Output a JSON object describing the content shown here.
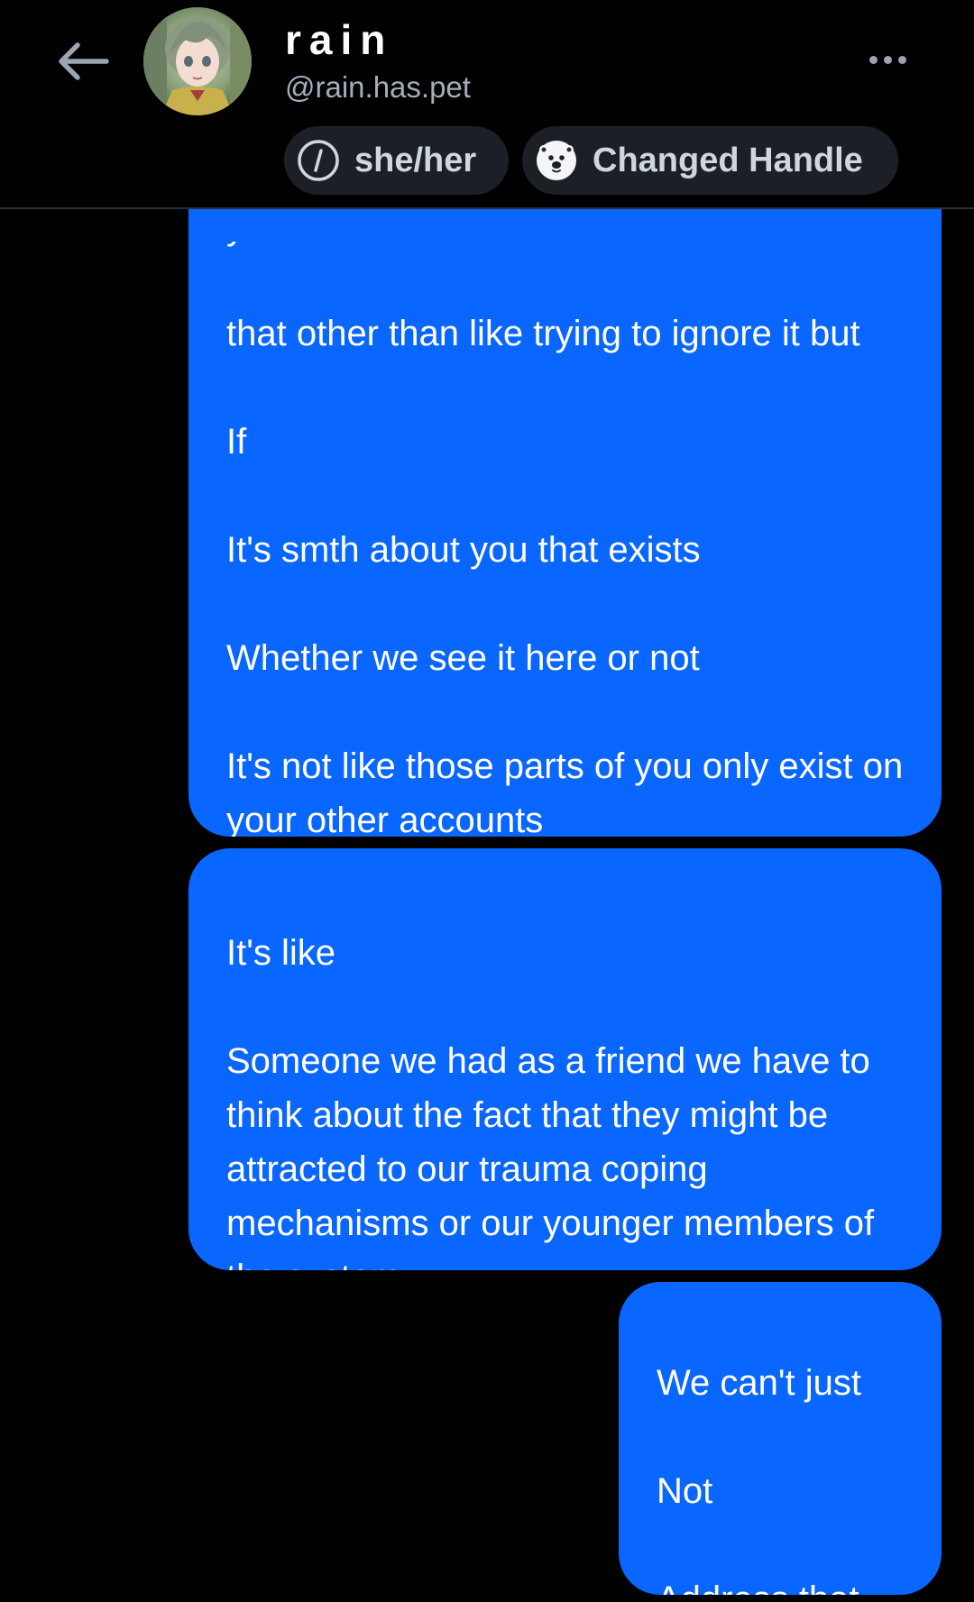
{
  "header": {
    "display_name": "rain",
    "handle": "@rain.has.pet",
    "labels": [
      {
        "text": "she/her",
        "icon": "pronouns-slash-icon"
      },
      {
        "text": "Changed Handle",
        "icon": "seal-face-icon"
      }
    ]
  },
  "messages": [
    {
      "sender": "self",
      "text": "that other than like trying to ignore it but\n\nIf\n\nIt's smth about you that exists\n\nWhether we see it here or not\n\nIt's not like those parts of you only exist on your other accounts"
    },
    {
      "sender": "self",
      "text": "It's like\n\nSomeone we had as a friend we have to think about the fact that they might be attracted to our trauma coping mechanisms or our younger members of the system"
    },
    {
      "sender": "self",
      "text": "We can't just\n\nNot\n\nAddress that"
    }
  ],
  "colors": {
    "background": "#000000",
    "bubble": "#0966ff",
    "pill": "#1c2026",
    "handle_text": "#a3adbb",
    "header_border": "#2b313a"
  },
  "icons": {
    "back": "arrow-left-icon",
    "more": "more-horizontal-icon",
    "avatar": "anime-character-avatar"
  }
}
